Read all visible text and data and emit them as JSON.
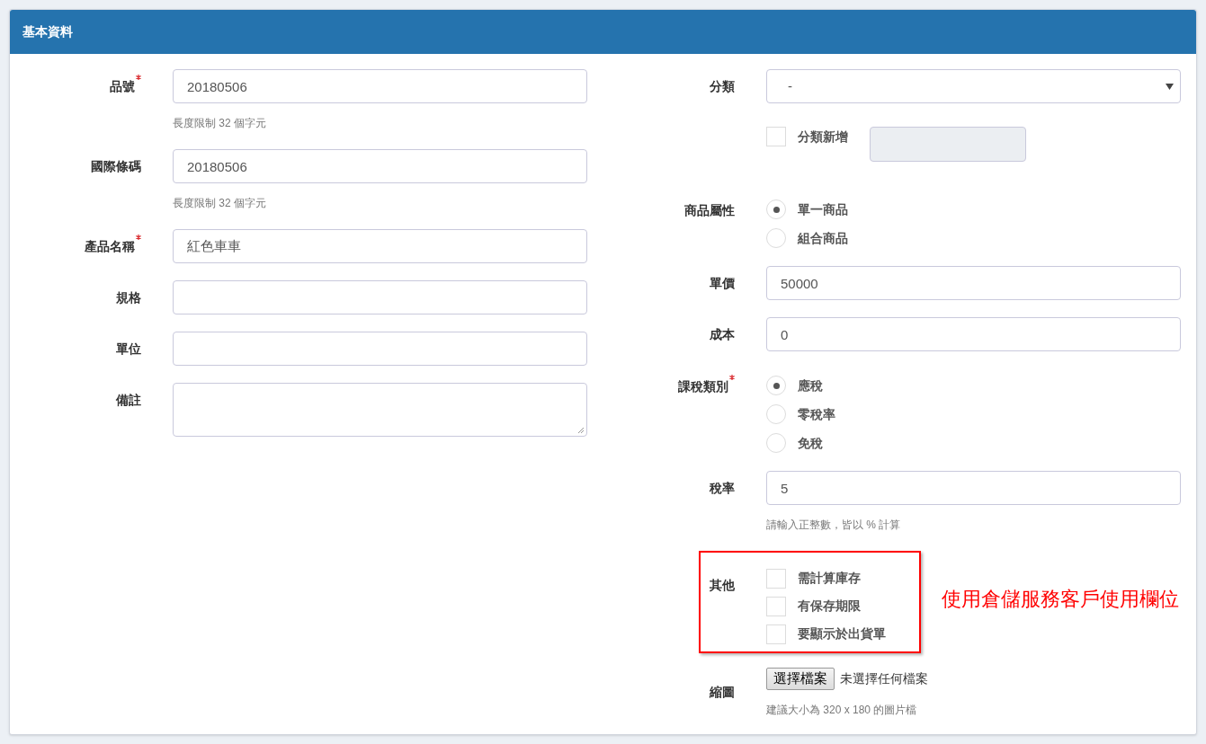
{
  "panel": {
    "title": "基本資料"
  },
  "left_fields": [
    {
      "kind": "text",
      "label": "品號",
      "required": true,
      "value": "20180506",
      "help": "長度限制 32 個字元"
    },
    {
      "kind": "text",
      "label": "國際條碼",
      "required": false,
      "value": "20180506",
      "help": "長度限制 32 個字元"
    },
    {
      "kind": "text",
      "label": "產品名稱",
      "required": true,
      "value": "紅色車車"
    },
    {
      "kind": "text",
      "label": "規格",
      "required": false
    },
    {
      "kind": "text",
      "label": "單位",
      "required": false
    },
    {
      "kind": "textarea",
      "label": "備註",
      "required": false
    }
  ],
  "right_fields": [
    {
      "kind": "select",
      "label": "分類",
      "required": false,
      "value": "-",
      "add_option": {
        "label": "分類新增",
        "checked": false,
        "field_disabled": true
      }
    },
    {
      "kind": "radio",
      "label": "商品屬性",
      "required": false,
      "options": [
        {
          "label": "單一商品",
          "selected": true
        },
        {
          "label": "組合商品",
          "selected": false
        }
      ]
    },
    {
      "kind": "text",
      "label": "單價",
      "required": false,
      "value": "50000"
    },
    {
      "kind": "text",
      "label": "成本",
      "required": false,
      "value": "0"
    },
    {
      "kind": "radio",
      "label": "課稅類別",
      "required": true,
      "options": [
        {
          "label": "應稅",
          "selected": true
        },
        {
          "label": "零稅率",
          "selected": false
        },
        {
          "label": "免稅",
          "selected": false
        }
      ]
    },
    {
      "kind": "text",
      "label": "稅率",
      "required": false,
      "value": "5",
      "help": "請輸入正整數，皆以 % 計算"
    },
    {
      "kind": "checkboxes",
      "label": "其他",
      "required": false,
      "highlighted": true,
      "annotation": "使用倉儲服務客戶使用欄位",
      "options": [
        {
          "label": "需計算庫存",
          "checked": false
        },
        {
          "label": "有保存期限",
          "checked": false
        },
        {
          "label": "要顯示於出貨單",
          "checked": false
        }
      ]
    },
    {
      "kind": "file",
      "label": "縮圖",
      "required": false,
      "button": "選擇檔案",
      "status": "未選擇任何檔案",
      "help": "建議大小為 320 x 180 的圖片檔"
    }
  ]
}
